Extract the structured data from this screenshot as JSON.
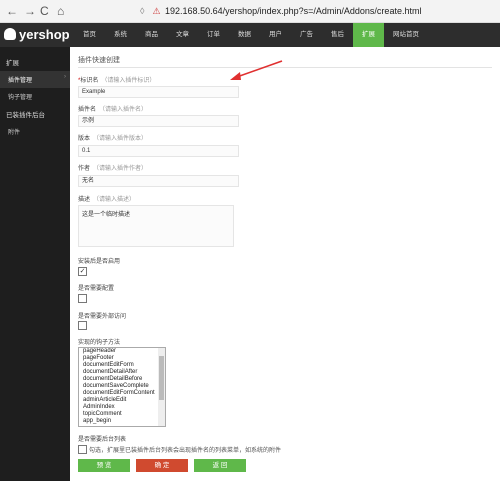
{
  "browser": {
    "back": "←",
    "forward": "→",
    "reload": "C",
    "home": "⌂",
    "url": "192.168.50.64/yershop/index.php?s=/Admin/Addons/create.html"
  },
  "brand": "yershop",
  "menu": [
    "首页",
    "系统",
    "商品",
    "文章",
    "订单",
    "数据",
    "用户",
    "广告",
    "售后",
    "扩展",
    "网站首页"
  ],
  "sidebar": {
    "header1": "扩展",
    "items1": [
      "插件管理",
      "钩子管理"
    ],
    "header2": "已装插件后台",
    "items2": [
      "附件"
    ]
  },
  "page_title": "插件快速创建",
  "form": {
    "name": {
      "label": "标识名",
      "hint": "（请输入插件标识）",
      "value": "Example"
    },
    "title": {
      "label": "插件名",
      "hint": "（请输入插件名）",
      "value": "示例"
    },
    "version": {
      "label": "版本",
      "hint": "（请输入插件版本）",
      "value": "0.1"
    },
    "author": {
      "label": "作者",
      "hint": "（请输入插件作者）",
      "value": "无名"
    },
    "description": {
      "label": "描述",
      "hint": "（请输入描述）",
      "value": "这是一个临时描述"
    },
    "enable_after_install": {
      "label": "安装后是否启用",
      "checked": true
    },
    "need_config": {
      "label": "是否需要配置",
      "checked": false
    },
    "external_access": {
      "label": "是否需要外部访问",
      "checked": false
    },
    "hooks": {
      "label": "实现的钩子方法",
      "options": [
        "pageHeader",
        "pageFooter",
        "documentEditForm",
        "documentDetailAfter",
        "documentDetailBefore",
        "documentSaveComplete",
        "documentEditFormContent",
        "adminArticleEdit",
        "AdminIndex",
        "topicComment",
        "app_begin"
      ]
    },
    "admin_list": {
      "label": "是否需要后台列表",
      "description": "勾选，扩展里已装插件后台列表会出现插件名的列表菜单，如系统的附件"
    }
  },
  "buttons": {
    "preview": "预 览",
    "confirm": "确 定",
    "back": "返 回"
  },
  "colors": {
    "accent": "#5fb84a",
    "danger": "#d04a2f",
    "annotation": "#e03030"
  }
}
